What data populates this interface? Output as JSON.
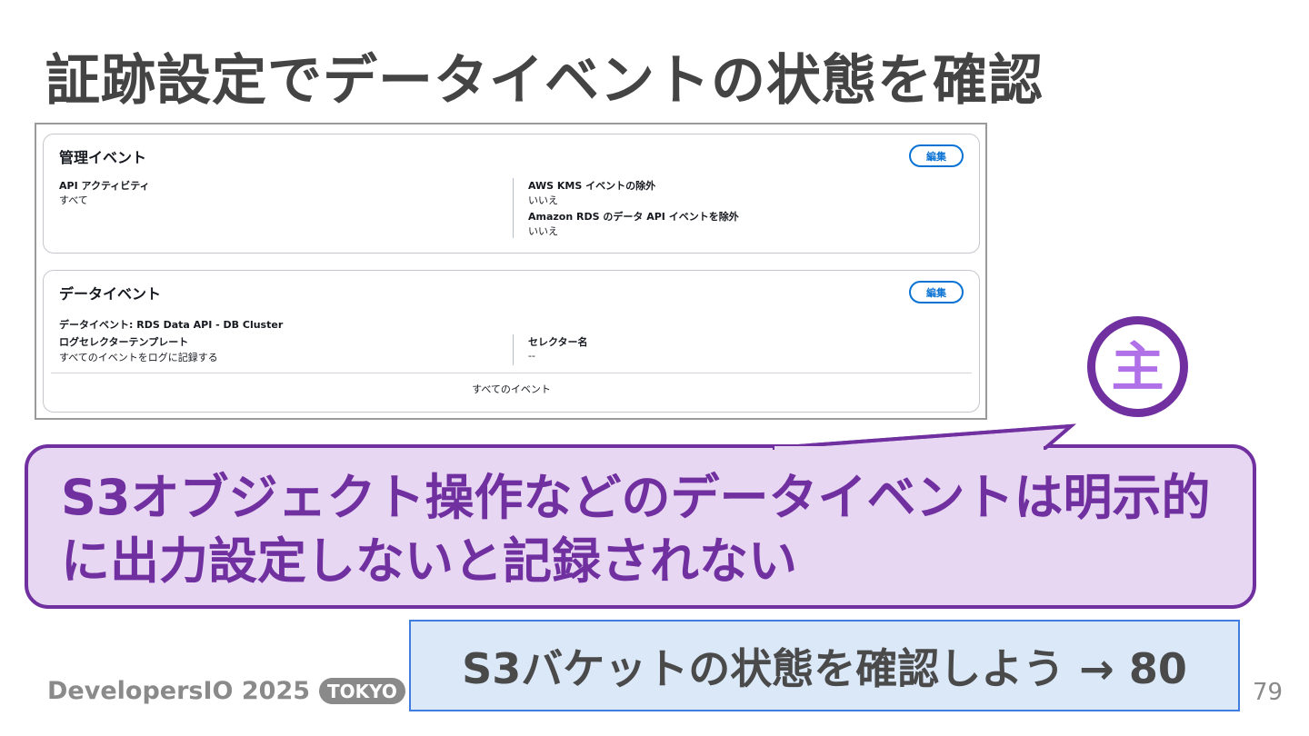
{
  "slide": {
    "title": "証跡設定でデータイベントの状態を確認",
    "page_number": "79"
  },
  "management_events": {
    "heading": "管理イベント",
    "edit_label": "編集",
    "api_activity_label": "API アクティビティ",
    "api_activity_value": "すべて",
    "kms_exclude_label": "AWS KMS イベントの除外",
    "kms_exclude_value": "いいえ",
    "rds_exclude_label": "Amazon RDS のデータ API イベントを除外",
    "rds_exclude_value": "いいえ"
  },
  "data_events": {
    "heading": "データイベント",
    "edit_label": "編集",
    "source_line": "データイベント: RDS Data API - DB Cluster",
    "template_label": "ログセレクターテンプレート",
    "template_value": "すべてのイベントをログに記録する",
    "selector_label": "セレクター名",
    "selector_value": "--",
    "all_events": "すべてのイベント"
  },
  "callout": {
    "text": "S3オブジェクト操作などのデータイベントは明示的に出力設定しないと記録されない",
    "icon_char": "主"
  },
  "next": {
    "text": "S3バケットの状態を確認しよう → 80"
  },
  "brand": {
    "name": "DevelopersIO 2025",
    "badge": "TOKYO"
  },
  "colors": {
    "accent_purple": "#7030a0",
    "bubble_fill": "#e8d7f3",
    "next_box_fill": "#dbe8f8",
    "next_box_border": "#3f7ee0",
    "console_link_blue": "#0972d3"
  }
}
